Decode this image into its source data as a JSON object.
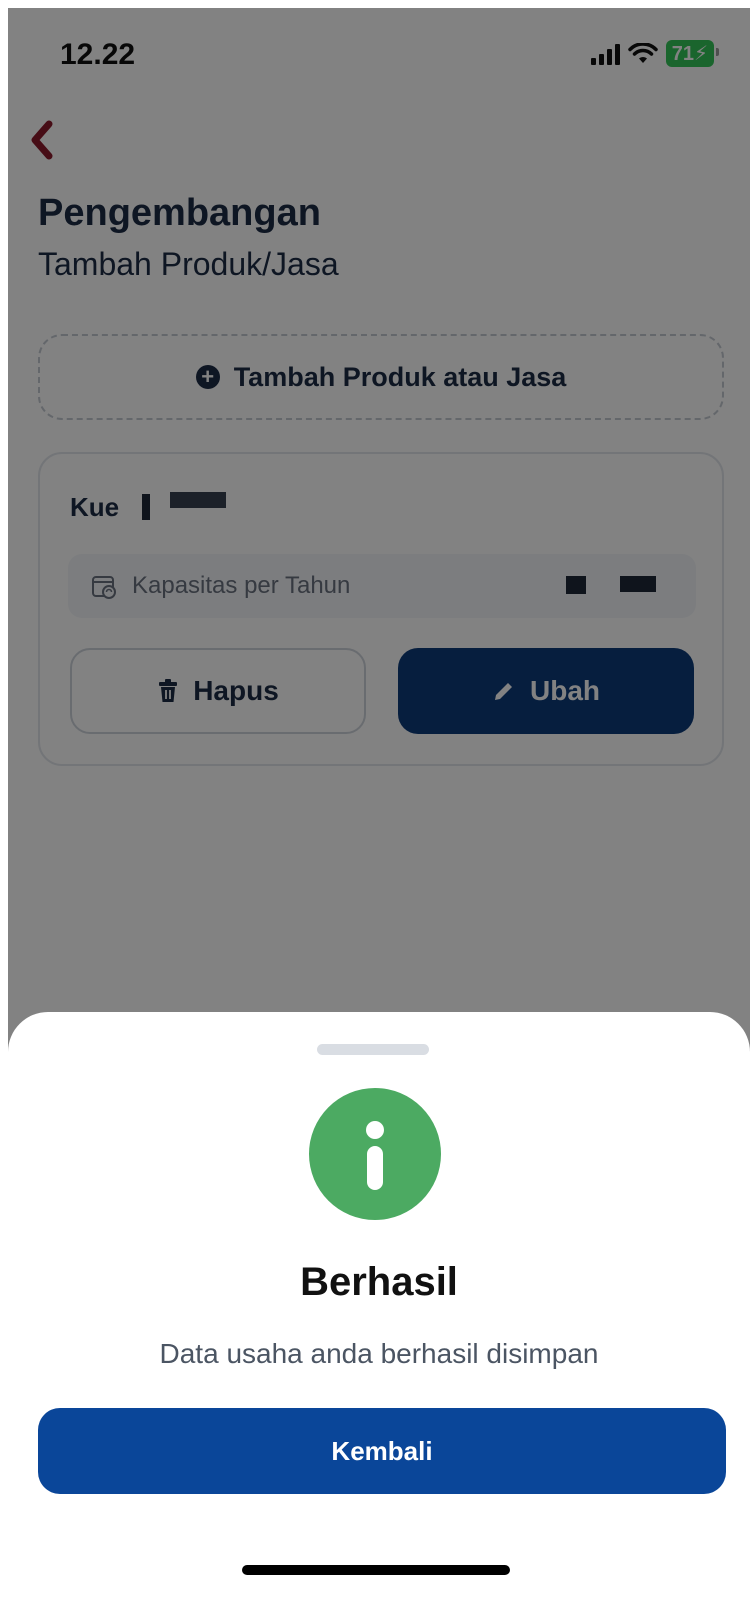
{
  "status_bar": {
    "time": "12.22",
    "battery": "71"
  },
  "header": {
    "title": "Pengembangan",
    "subtitle": "Tambah Produk/Jasa"
  },
  "add_button": {
    "label": "Tambah Produk atau Jasa"
  },
  "product_card": {
    "name": "Kue",
    "capacity_label": "Kapasitas per Tahun",
    "delete_label": "Hapus",
    "edit_label": "Ubah"
  },
  "dialog": {
    "title": "Berhasil",
    "message": "Data usaha anda berhasil disimpan",
    "back_label": "Kembali"
  },
  "colors": {
    "primary": "#0a4699",
    "success": "#4caa62",
    "accent_back": "#8b1a2b",
    "text_dark": "#1c2b45"
  }
}
